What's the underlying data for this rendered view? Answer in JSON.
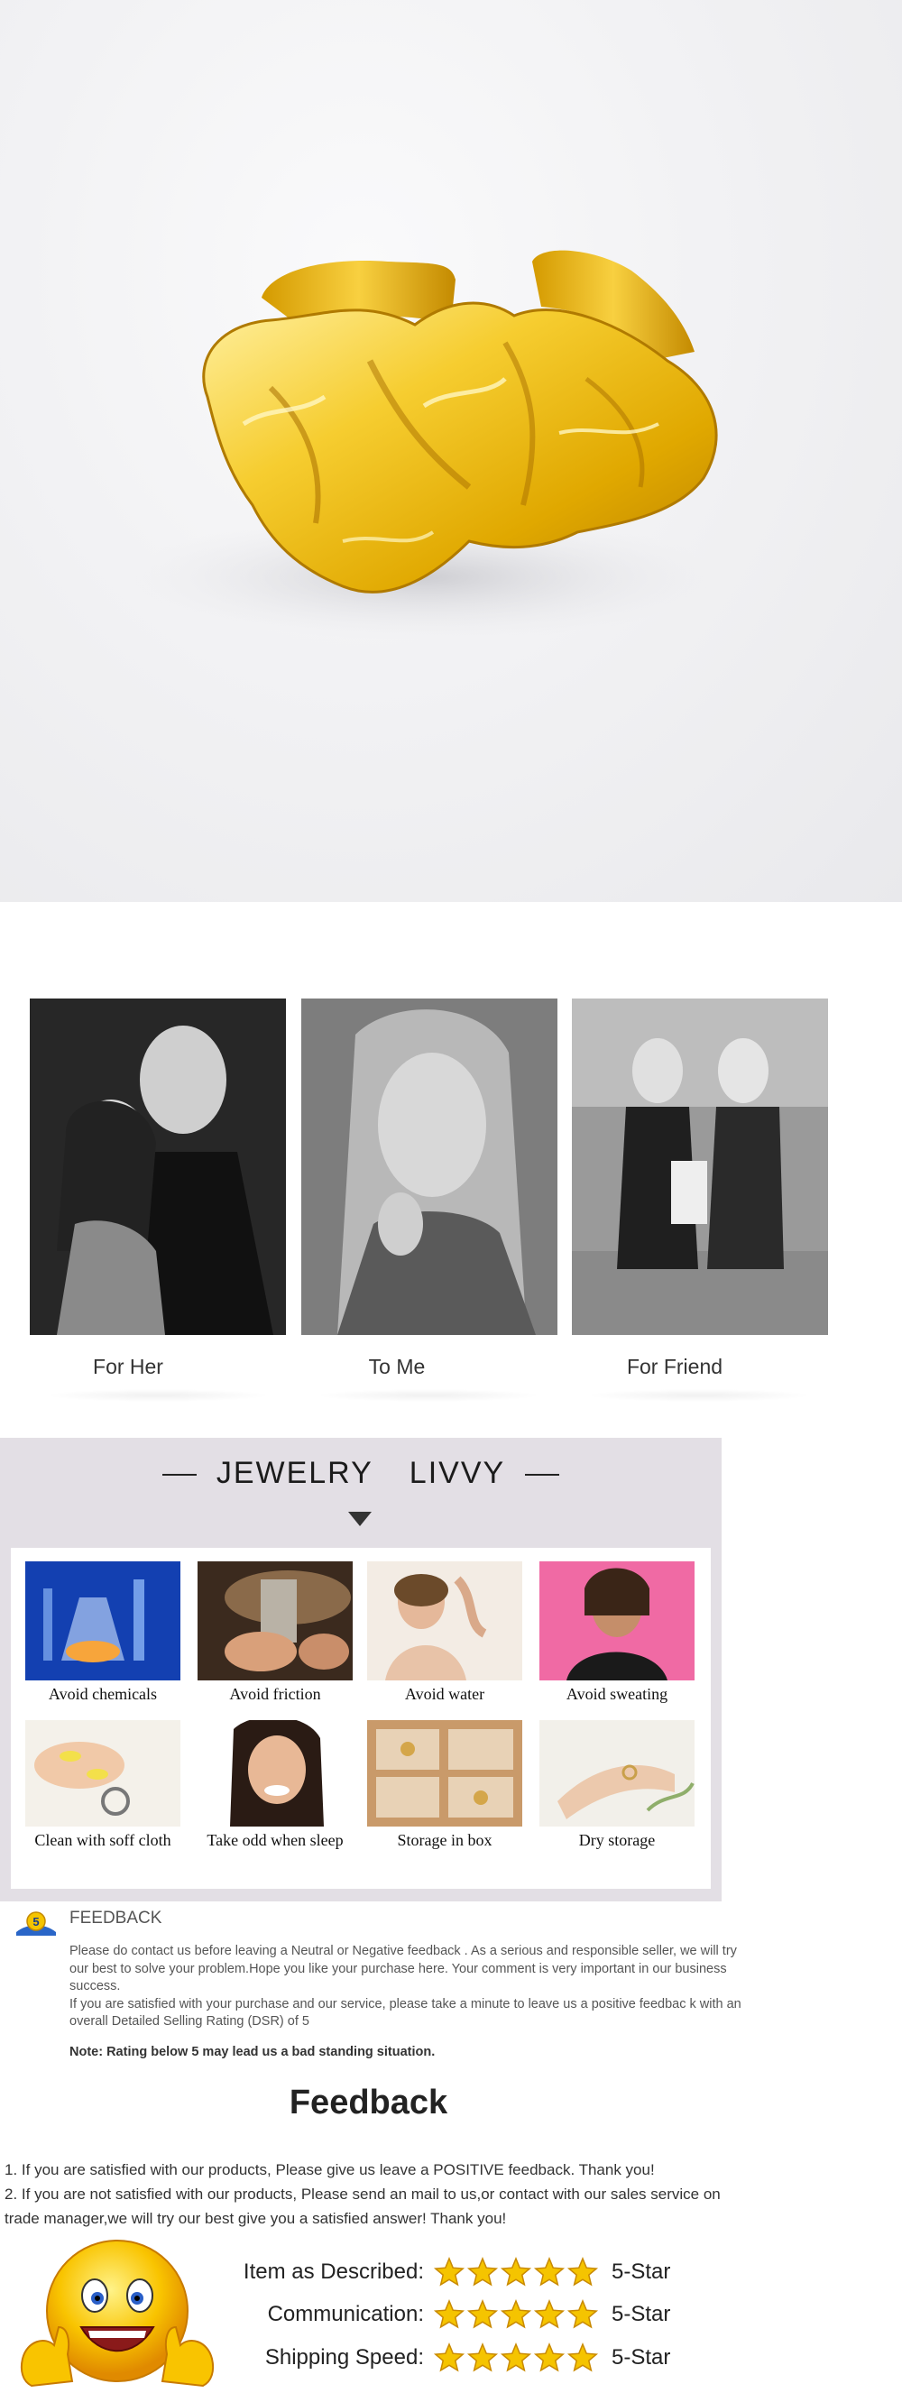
{
  "gifts": {
    "items": [
      {
        "label": "For Her"
      },
      {
        "label": "To Me"
      },
      {
        "label": "For Friend"
      }
    ]
  },
  "care": {
    "brand_left": "JEWELRY",
    "brand_right": "LIVVY",
    "items": [
      {
        "label": "Avoid chemicals"
      },
      {
        "label": "Avoid friction"
      },
      {
        "label": "Avoid water"
      },
      {
        "label": "Avoid sweating"
      },
      {
        "label": "Clean with soff cloth"
      },
      {
        "label": "Take odd when sleep"
      },
      {
        "label": "Storage in box"
      },
      {
        "label": "Dry storage"
      }
    ]
  },
  "feedback_note": {
    "logo_text": "5",
    "heading": "FEEDBACK",
    "paragraph_1": "Please do contact us before leaving a Neutral or Negative  feedback . As a serious and responsible seller, we will try our best to solve your problem.Hope you like your purchase here. Your comment is very important in our business success.",
    "paragraph_2": " If you are satisfied with your purchase and our service,  please take a minute to leave us  a positive feedbac k with an overall  Detailed Selling Rating (DSR) of 5",
    "note": "Note: Rating below 5 may lead us a bad standing situation."
  },
  "feedback_footer": {
    "title": "Feedback",
    "line_1": "1. If you are satisfied with our products, Please give us leave a POSITIVE feedback. Thank you!",
    "line_2": "2. If you are not satisfied with our products, Please send an mail to us,or contact with our sales service on trade manager,we will try our best give you a satisfied answer! Thank you!",
    "ratings": [
      {
        "label": "Item as Described:",
        "stars": 5,
        "value": "5-Star"
      },
      {
        "label": "Communication:",
        "stars": 5,
        "value": "5-Star"
      },
      {
        "label": "Shipping Speed:",
        "stars": 5,
        "value": "5-Star"
      }
    ],
    "star_color": "#f5c400"
  }
}
